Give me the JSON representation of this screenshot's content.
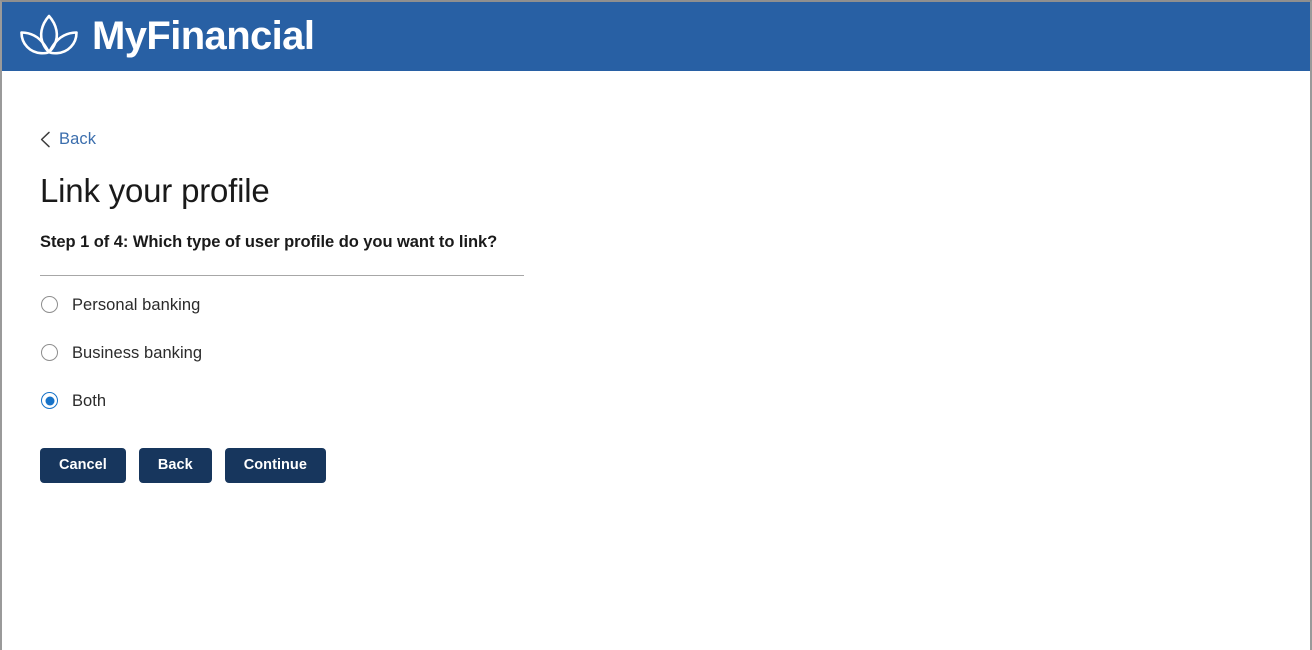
{
  "header": {
    "brand_name": "MyFinancial",
    "logo_icon": "lotus-flower-icon",
    "background_color": "#2860a4"
  },
  "content": {
    "back_link": {
      "label": "Back",
      "icon": "chevron-left-icon",
      "color": "#3b6ead"
    },
    "page_title": "Link your profile",
    "step_text": "Step 1 of 4: Which type of user profile do you want to link?",
    "profile_type_options": [
      {
        "label": "Personal banking",
        "selected": false
      },
      {
        "label": "Business banking",
        "selected": false
      },
      {
        "label": "Both",
        "selected": true
      }
    ],
    "selected_option": "Both",
    "buttons": [
      {
        "label": "Cancel",
        "name": "cancel-button"
      },
      {
        "label": "Back",
        "name": "back-button"
      },
      {
        "label": "Continue",
        "name": "continue-button"
      }
    ],
    "accent_color": "#1672c8",
    "button_color": "#17365d"
  }
}
